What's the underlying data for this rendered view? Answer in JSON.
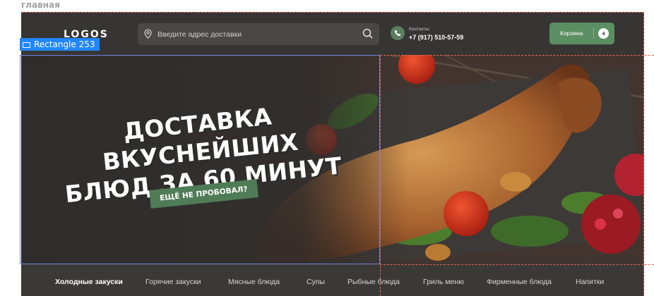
{
  "figma": {
    "frame_label": "главная",
    "selection_label": "Rectangle 253"
  },
  "header": {
    "logo": "LOGOS",
    "search_placeholder": "Введите адрес доставки",
    "contacts_label": "Контакты:",
    "phone": "+7 (917) 510-57-59",
    "cart_label": "Корзина",
    "cart_count": "4"
  },
  "hero": {
    "title_line1": "ДОСТАВКА ВКУСНЕЙШИХ",
    "title_line2": "БЛЮД ЗА 60 МИНУТ",
    "cta": "ЕЩЁ НЕ ПРОБОВАЛ?"
  },
  "nav": {
    "items": [
      {
        "label": "Холодные закуски"
      },
      {
        "label": "Горячие закуски"
      },
      {
        "label": "Мясные блюда"
      },
      {
        "label": "Супы"
      },
      {
        "label": "Рыбные блюда"
      },
      {
        "label": "Гриль меню"
      },
      {
        "label": "Фирменные блюда"
      },
      {
        "label": "Напитки"
      }
    ]
  },
  "colors": {
    "background": "#373533",
    "accent_green": "#5c8e63",
    "selection_blue": "#1f86ff",
    "guide_red": "#e8664a"
  }
}
